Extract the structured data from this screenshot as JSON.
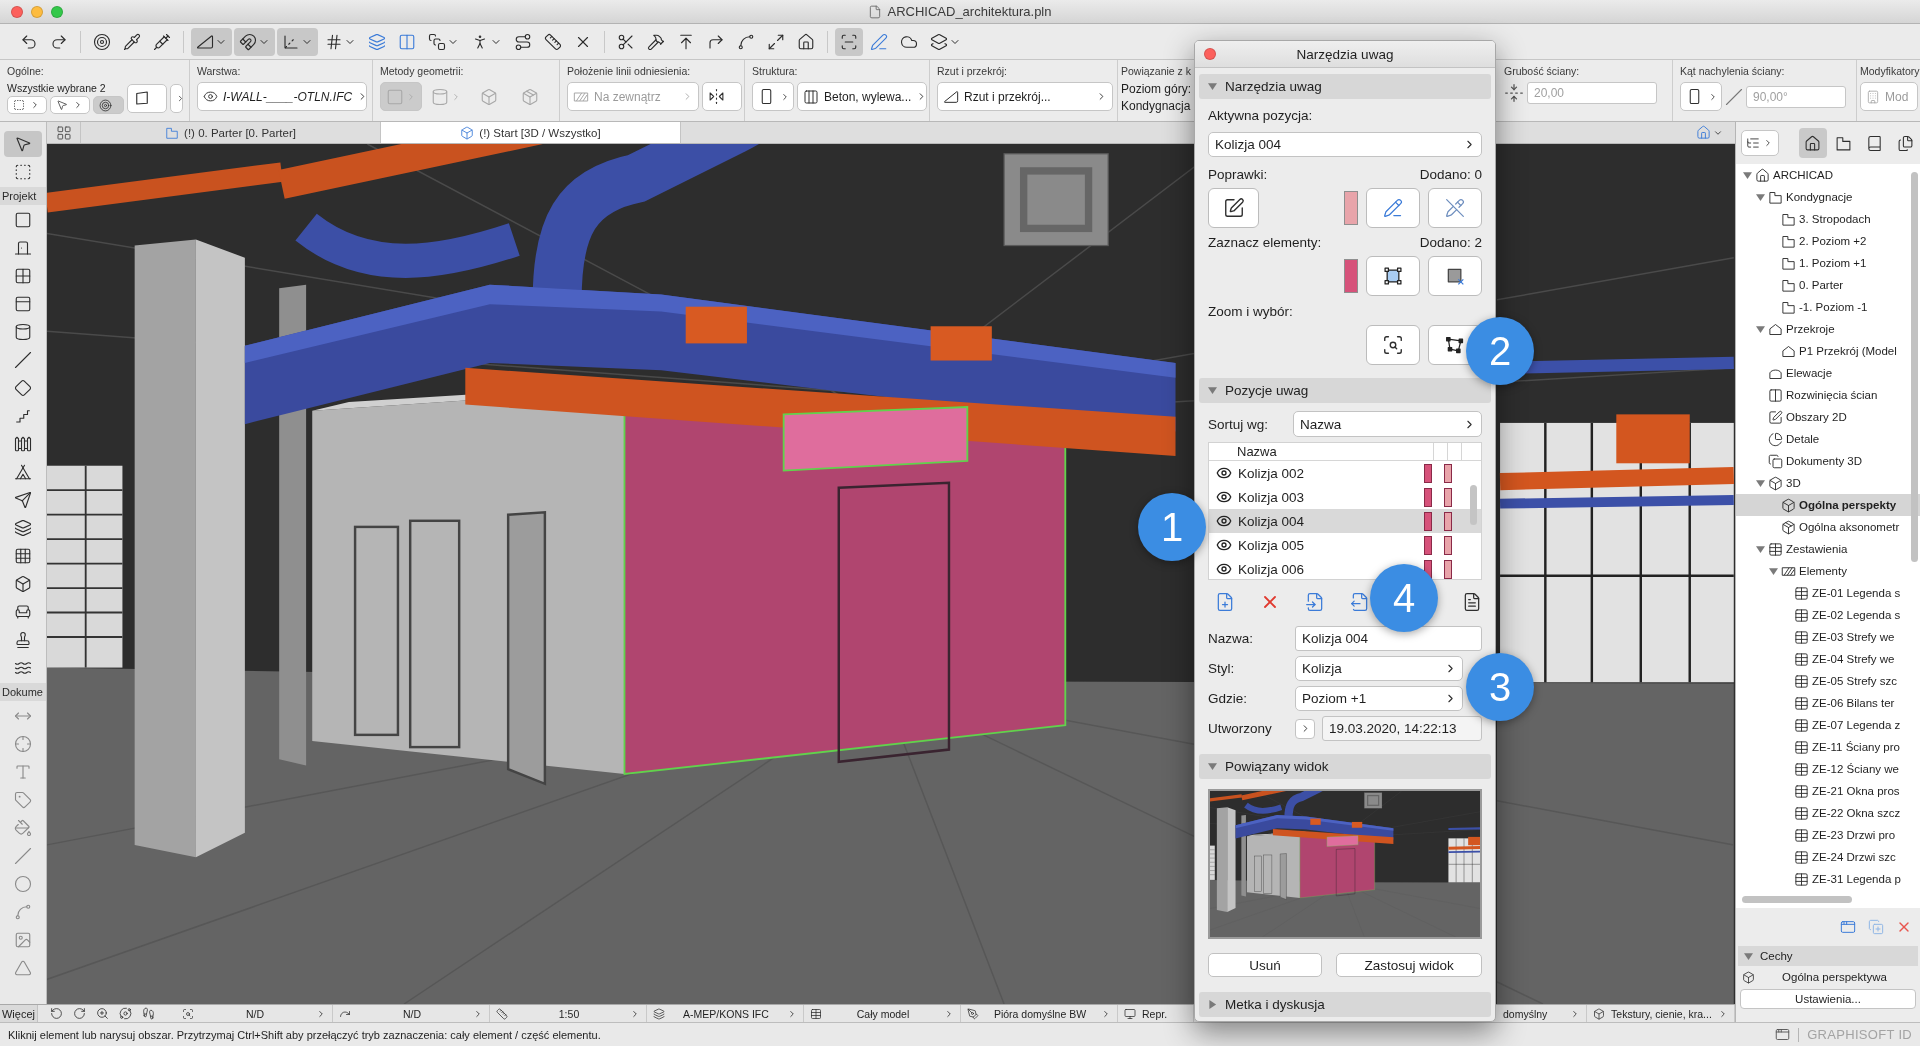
{
  "window": {
    "title": "ARCHICAD_architektura.pln"
  },
  "toolbar": [
    {
      "on": false
    },
    {
      "on": false
    },
    {
      "on": false
    },
    {
      "on": false
    },
    {
      "on": false
    },
    {
      "on": true
    },
    {
      "on": true
    },
    {
      "on": true
    },
    {
      "on": false
    },
    {
      "on": false
    },
    {
      "on": false
    },
    {
      "on": false
    },
    {
      "on": false
    },
    {
      "on": false
    },
    {
      "on": false
    },
    {
      "on": false
    },
    {
      "on": false
    },
    {
      "on": false
    },
    {
      "on": false
    },
    {
      "on": false
    },
    {
      "on": false
    },
    {
      "on": false
    },
    {
      "on": false
    },
    {
      "on": true
    },
    {
      "on": false
    },
    {
      "on": false
    },
    {
      "on": false
    }
  ],
  "info_box": {
    "general": {
      "label": "Ogólne:",
      "selection": "Wszystkie wybrane 2",
      "tools": [
        {
          "on": false
        },
        {
          "on": false
        },
        {
          "on": true
        }
      ]
    },
    "layer": {
      "label": "Warstwa:",
      "value": "I-WALL-____-OTLN.IFC"
    },
    "geometry": {
      "label": "Metody geometrii:",
      "disabled": true,
      "methods": [
        {
          "selected": true
        },
        {
          "selected": false
        },
        {
          "selected": false
        },
        {
          "selected": false
        }
      ]
    },
    "reference_line": {
      "label": "Położenie linii odniesienia:",
      "value": "Na zewnątrz",
      "disabled": true
    },
    "structure": {
      "label": "Struktura:",
      "value": "Beton, wylewa..."
    },
    "floor_plan": {
      "label": "Rzut i przekrój:",
      "value": "Rzut i przekrój..."
    },
    "link": {
      "label": "Powiązanie z k",
      "top": "Poziom góry:",
      "story": "Kondygnacja"
    },
    "thickness": {
      "label": "Grubość ściany:",
      "value": "20,00",
      "disabled": true
    },
    "slant": {
      "label": "Kąt nachylenia ściany:",
      "value": "90,00°",
      "disabled": true
    },
    "modifiers": {
      "label": "Modyfikatory",
      "value": "Mod",
      "disabled": true
    }
  },
  "tabs": [
    {
      "label": "(!) 0. Parter [0. Parter]",
      "kind": "plan",
      "selected": false
    },
    {
      "label": "(!) Start [3D / Wszystko]",
      "kind": "model",
      "selected": true
    }
  ],
  "toolbox": {
    "pointer_tools": [
      {
        "selected": true
      },
      {
        "selected": false
      }
    ],
    "design_label": "Projekt",
    "design_tools": [
      {
        "selected": false
      },
      {
        "selected": false
      },
      {
        "selected": false
      },
      {
        "selected": false
      },
      {
        "selected": false
      },
      {
        "selected": false
      },
      {
        "selected": false
      },
      {
        "selected": false
      },
      {
        "selected": false
      },
      {
        "selected": false
      },
      {
        "selected": false
      },
      {
        "selected": false
      },
      {
        "selected": false
      },
      {
        "selected": false
      },
      {
        "selected": false
      },
      {
        "selected": false
      },
      {
        "selected": false
      }
    ],
    "document_label": "Dokume",
    "document_tools": [
      {
        "selected": false
      },
      {
        "selected": false
      },
      {
        "selected": false
      },
      {
        "selected": false
      },
      {
        "selected": false
      },
      {
        "selected": false
      },
      {
        "selected": false
      },
      {
        "selected": false
      },
      {
        "selected": false
      },
      {
        "selected": false
      }
    ],
    "more": "Więcej"
  },
  "quick_options": [
    "N/D",
    "N/D",
    "1:50",
    "A-MEP/KONS IFC",
    "Cały model",
    "Pióra domyślne BW",
    "Repr.",
    "domyślny",
    "Tekstury, cienie, kra..."
  ],
  "palette": {
    "title": "Narzędzia uwag",
    "tools": {
      "title": "Narzędzia uwag",
      "expanded": true,
      "active_label": "Aktywna pozycja:",
      "active_value": "Kolizja 004",
      "marks": [
        {
          "label": "Poprawki:",
          "count": "Dodano: 0",
          "color": "#e8a4aa"
        },
        {
          "label": "Zaznacz elementy:",
          "count": "Dodano: 2",
          "color": "#d6527a"
        }
      ],
      "zoom_label": "Zoom i wybór:"
    },
    "items": {
      "title": "Pozycje uwag",
      "expanded": true,
      "sort_label": "Sortuj wg:",
      "sort_value": "Nazwa",
      "column": "Nazwa",
      "rows": [
        {
          "name": "Kolizja 002",
          "selected": false
        },
        {
          "name": "Kolizja 003",
          "selected": false
        },
        {
          "name": "Kolizja 004",
          "selected": true
        },
        {
          "name": "Kolizja 005",
          "selected": false
        },
        {
          "name": "Kolizja 006",
          "selected": false
        }
      ],
      "fields": [
        {
          "label": "Nazwa:",
          "value": "Kolizja 004",
          "kind": "text"
        },
        {
          "label": "Styl:",
          "value": "Kolizja",
          "kind": "select"
        },
        {
          "label": "Gdzie:",
          "value": "Poziom +1",
          "kind": "select"
        },
        {
          "label": "Utworzony",
          "value": "19.03.2020, 14:22:13",
          "kind": "date"
        }
      ]
    },
    "view": {
      "title": "Powiązany widok",
      "expanded": true,
      "buttons": [
        "Usuń",
        "Zastosuj widok"
      ]
    },
    "tag": {
      "title": "Metka i dyskusja",
      "expanded": false
    }
  },
  "callouts": [
    "1",
    "2",
    "3",
    "4"
  ],
  "navigator": {
    "views": [
      {
        "selected": true
      },
      {
        "selected": false
      },
      {
        "selected": false
      },
      {
        "selected": false
      }
    ],
    "tree": [
      {
        "label": "ARCHICAD",
        "kind": "project",
        "expanded": true,
        "selected": false,
        "children": [
          {
            "label": "Kondygnacje",
            "kind": "stories",
            "expanded": true,
            "selected": false,
            "children": [
              {
                "label": "3. Stropodach",
                "kind": "story",
                "selected": false
              },
              {
                "label": "2. Poziom +2",
                "kind": "story",
                "selected": false
              },
              {
                "label": "1. Poziom +1",
                "kind": "story",
                "selected": false
              },
              {
                "label": "0. Parter",
                "kind": "story",
                "selected": false
              },
              {
                "label": "-1. Poziom -1",
                "kind": "story",
                "selected": false
              }
            ]
          },
          {
            "label": "Przekroje",
            "kind": "sections",
            "expanded": true,
            "selected": false,
            "children": [
              {
                "label": "P1 Przekrój (Model",
                "kind": "section",
                "selected": false
              }
            ]
          },
          {
            "label": "Elewacje",
            "kind": "elevations",
            "selected": false
          },
          {
            "label": "Rozwinięcia ścian",
            "kind": "interiors",
            "selected": false
          },
          {
            "label": "Obszary 2D",
            "kind": "worksheets",
            "selected": false
          },
          {
            "label": "Detale",
            "kind": "details",
            "selected": false
          },
          {
            "label": "Dokumenty 3D",
            "kind": "documents",
            "selected": false
          },
          {
            "label": "3D",
            "kind": "views",
            "expanded": true,
            "selected": false,
            "children": [
              {
                "label": "Ogólna perspekty",
                "kind": "perspective",
                "selected": true
              },
              {
                "label": "Ogólna aksonometr",
                "kind": "axonometry",
                "selected": false
              }
            ]
          },
          {
            "label": "Zestawienia",
            "kind": "schedules",
            "expanded": true,
            "selected": false,
            "children": [
              {
                "label": "Elementy",
                "kind": "elements",
                "expanded": true,
                "selected": false,
                "children": [
                  {
                    "label": "ZE-01 Legenda s",
                    "kind": "schedule",
                    "selected": false
                  },
                  {
                    "label": "ZE-02 Legenda s",
                    "kind": "schedule",
                    "selected": false
                  },
                  {
                    "label": "ZE-03 Strefy we",
                    "kind": "schedule",
                    "selected": false
                  },
                  {
                    "label": "ZE-04 Strefy we",
                    "kind": "schedule",
                    "selected": false
                  },
                  {
                    "label": "ZE-05 Strefy szc",
                    "kind": "schedule",
                    "selected": false
                  },
                  {
                    "label": "ZE-06 Bilans ter",
                    "kind": "schedule",
                    "selected": false
                  },
                  {
                    "label": "ZE-07 Legenda z",
                    "kind": "schedule",
                    "selected": false
                  },
                  {
                    "label": "ZE-11 Ściany pro",
                    "kind": "schedule",
                    "selected": false
                  },
                  {
                    "label": "ZE-12 Ściany we",
                    "kind": "schedule",
                    "selected": false
                  },
                  {
                    "label": "ZE-21 Okna pros",
                    "kind": "schedule",
                    "selected": false
                  },
                  {
                    "label": "ZE-22 Okna szcz",
                    "kind": "schedule",
                    "selected": false
                  },
                  {
                    "label": "ZE-23 Drzwi pro",
                    "kind": "schedule",
                    "selected": false
                  },
                  {
                    "label": "ZE-24 Drzwi szc",
                    "kind": "schedule",
                    "selected": false
                  },
                  {
                    "label": "ZE-31 Legenda p",
                    "kind": "schedule",
                    "selected": false
                  }
                ]
              }
            ]
          }
        ]
      }
    ],
    "properties": {
      "title": "Cechy",
      "expanded": true,
      "view_name": "Ogólna perspektywa",
      "button": "Ustawienia..."
    }
  },
  "status_bar": {
    "message": "Kliknij element lub narysuj obszar. Przytrzymaj Ctrl+Shift aby przełączyć tryb zaznaczenia: cały element / część elementu.",
    "brand": "GRAPHISOFT ID"
  }
}
